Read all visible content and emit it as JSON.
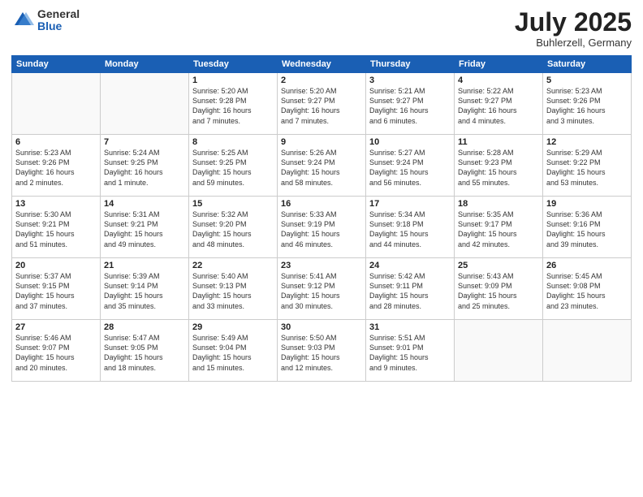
{
  "logo": {
    "general": "General",
    "blue": "Blue"
  },
  "title": {
    "month": "July 2025",
    "location": "Buhlerzell, Germany"
  },
  "weekdays": [
    "Sunday",
    "Monday",
    "Tuesday",
    "Wednesday",
    "Thursday",
    "Friday",
    "Saturday"
  ],
  "weeks": [
    [
      {
        "day": "",
        "info": ""
      },
      {
        "day": "",
        "info": ""
      },
      {
        "day": "1",
        "info": "Sunrise: 5:20 AM\nSunset: 9:28 PM\nDaylight: 16 hours\nand 7 minutes."
      },
      {
        "day": "2",
        "info": "Sunrise: 5:20 AM\nSunset: 9:27 PM\nDaylight: 16 hours\nand 7 minutes."
      },
      {
        "day": "3",
        "info": "Sunrise: 5:21 AM\nSunset: 9:27 PM\nDaylight: 16 hours\nand 6 minutes."
      },
      {
        "day": "4",
        "info": "Sunrise: 5:22 AM\nSunset: 9:27 PM\nDaylight: 16 hours\nand 4 minutes."
      },
      {
        "day": "5",
        "info": "Sunrise: 5:23 AM\nSunset: 9:26 PM\nDaylight: 16 hours\nand 3 minutes."
      }
    ],
    [
      {
        "day": "6",
        "info": "Sunrise: 5:23 AM\nSunset: 9:26 PM\nDaylight: 16 hours\nand 2 minutes."
      },
      {
        "day": "7",
        "info": "Sunrise: 5:24 AM\nSunset: 9:25 PM\nDaylight: 16 hours\nand 1 minute."
      },
      {
        "day": "8",
        "info": "Sunrise: 5:25 AM\nSunset: 9:25 PM\nDaylight: 15 hours\nand 59 minutes."
      },
      {
        "day": "9",
        "info": "Sunrise: 5:26 AM\nSunset: 9:24 PM\nDaylight: 15 hours\nand 58 minutes."
      },
      {
        "day": "10",
        "info": "Sunrise: 5:27 AM\nSunset: 9:24 PM\nDaylight: 15 hours\nand 56 minutes."
      },
      {
        "day": "11",
        "info": "Sunrise: 5:28 AM\nSunset: 9:23 PM\nDaylight: 15 hours\nand 55 minutes."
      },
      {
        "day": "12",
        "info": "Sunrise: 5:29 AM\nSunset: 9:22 PM\nDaylight: 15 hours\nand 53 minutes."
      }
    ],
    [
      {
        "day": "13",
        "info": "Sunrise: 5:30 AM\nSunset: 9:21 PM\nDaylight: 15 hours\nand 51 minutes."
      },
      {
        "day": "14",
        "info": "Sunrise: 5:31 AM\nSunset: 9:21 PM\nDaylight: 15 hours\nand 49 minutes."
      },
      {
        "day": "15",
        "info": "Sunrise: 5:32 AM\nSunset: 9:20 PM\nDaylight: 15 hours\nand 48 minutes."
      },
      {
        "day": "16",
        "info": "Sunrise: 5:33 AM\nSunset: 9:19 PM\nDaylight: 15 hours\nand 46 minutes."
      },
      {
        "day": "17",
        "info": "Sunrise: 5:34 AM\nSunset: 9:18 PM\nDaylight: 15 hours\nand 44 minutes."
      },
      {
        "day": "18",
        "info": "Sunrise: 5:35 AM\nSunset: 9:17 PM\nDaylight: 15 hours\nand 42 minutes."
      },
      {
        "day": "19",
        "info": "Sunrise: 5:36 AM\nSunset: 9:16 PM\nDaylight: 15 hours\nand 39 minutes."
      }
    ],
    [
      {
        "day": "20",
        "info": "Sunrise: 5:37 AM\nSunset: 9:15 PM\nDaylight: 15 hours\nand 37 minutes."
      },
      {
        "day": "21",
        "info": "Sunrise: 5:39 AM\nSunset: 9:14 PM\nDaylight: 15 hours\nand 35 minutes."
      },
      {
        "day": "22",
        "info": "Sunrise: 5:40 AM\nSunset: 9:13 PM\nDaylight: 15 hours\nand 33 minutes."
      },
      {
        "day": "23",
        "info": "Sunrise: 5:41 AM\nSunset: 9:12 PM\nDaylight: 15 hours\nand 30 minutes."
      },
      {
        "day": "24",
        "info": "Sunrise: 5:42 AM\nSunset: 9:11 PM\nDaylight: 15 hours\nand 28 minutes."
      },
      {
        "day": "25",
        "info": "Sunrise: 5:43 AM\nSunset: 9:09 PM\nDaylight: 15 hours\nand 25 minutes."
      },
      {
        "day": "26",
        "info": "Sunrise: 5:45 AM\nSunset: 9:08 PM\nDaylight: 15 hours\nand 23 minutes."
      }
    ],
    [
      {
        "day": "27",
        "info": "Sunrise: 5:46 AM\nSunset: 9:07 PM\nDaylight: 15 hours\nand 20 minutes."
      },
      {
        "day": "28",
        "info": "Sunrise: 5:47 AM\nSunset: 9:05 PM\nDaylight: 15 hours\nand 18 minutes."
      },
      {
        "day": "29",
        "info": "Sunrise: 5:49 AM\nSunset: 9:04 PM\nDaylight: 15 hours\nand 15 minutes."
      },
      {
        "day": "30",
        "info": "Sunrise: 5:50 AM\nSunset: 9:03 PM\nDaylight: 15 hours\nand 12 minutes."
      },
      {
        "day": "31",
        "info": "Sunrise: 5:51 AM\nSunset: 9:01 PM\nDaylight: 15 hours\nand 9 minutes."
      },
      {
        "day": "",
        "info": ""
      },
      {
        "day": "",
        "info": ""
      }
    ]
  ]
}
